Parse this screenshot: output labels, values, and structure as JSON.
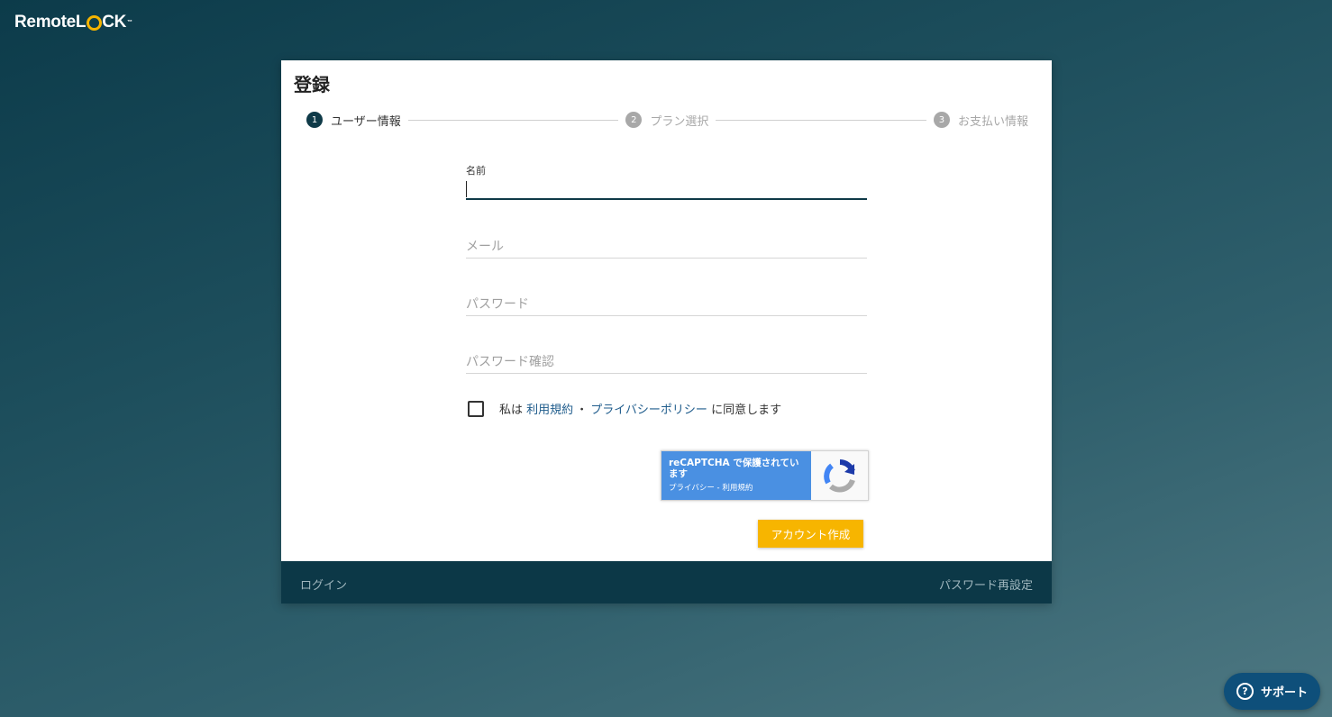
{
  "brand": {
    "remote": "Remote",
    "l": "L",
    "ck": "CK",
    "tm": "™"
  },
  "page": {
    "title": "登録"
  },
  "stepper": {
    "steps": [
      {
        "num": "1",
        "label": "ユーザー情報",
        "state": "active"
      },
      {
        "num": "2",
        "label": "プラン選択",
        "state": "inactive"
      },
      {
        "num": "3",
        "label": "お支払い情報",
        "state": "inactive"
      }
    ]
  },
  "form": {
    "name_label": "名前",
    "name_value": "",
    "email_placeholder": "メール",
    "password_placeholder": "パスワード",
    "password_confirm_placeholder": "パスワード確認",
    "agree": {
      "prefix": "私は",
      "terms_link": "利用規約",
      "separator": "・",
      "privacy_link": "プライバシーポリシー",
      "suffix": "に同意します",
      "checked": false
    },
    "recaptcha": {
      "main_text": "reCAPTCHA で保護されています",
      "privacy": "プライバシー",
      "separator": " - ",
      "terms": "利用規約"
    },
    "submit_label": "アカウント作成"
  },
  "footer": {
    "login": "ログイン",
    "password_reset": "パスワード再設定"
  },
  "support": {
    "icon": "?",
    "label": "サポート"
  },
  "colors": {
    "accent_dark": "#0f3a48",
    "button_yellow": "#f7b500",
    "link_blue": "#1f5c8c",
    "recaptcha_blue": "#4a90e2",
    "support_blue": "#0e4f7a"
  }
}
